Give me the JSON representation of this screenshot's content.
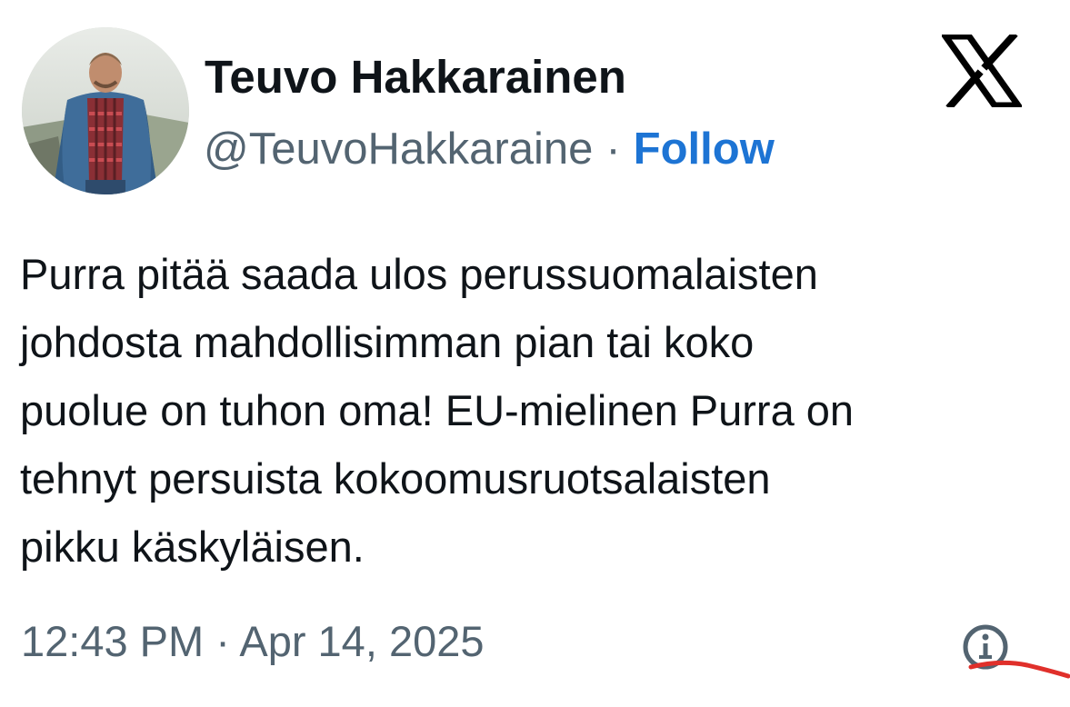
{
  "author": {
    "display_name": "Teuvo Hakkarainen",
    "handle": "@TeuvoHakkaraine",
    "separator": "·",
    "follow_label": "Follow",
    "avatar_icon": "profile-photo-avatar"
  },
  "platform": {
    "logo_icon": "x-logo-icon"
  },
  "tweet": {
    "text": "Purra pitää saada ulos perussuomalaisten\njohdosta mahdollisimman pian tai koko\npuolue on tuhon oma! EU-mielinen Purra on\ntehnyt persuista kokoomusruotsalaisten\npikku käskyläisen.",
    "timestamp": "12:43 PM · Apr 14, 2025",
    "info_icon": "info-icon"
  },
  "colors": {
    "text": "#0f1419",
    "secondary": "#536471",
    "follow_blue": "#1d74d4",
    "annotation_red": "#e0302b"
  }
}
